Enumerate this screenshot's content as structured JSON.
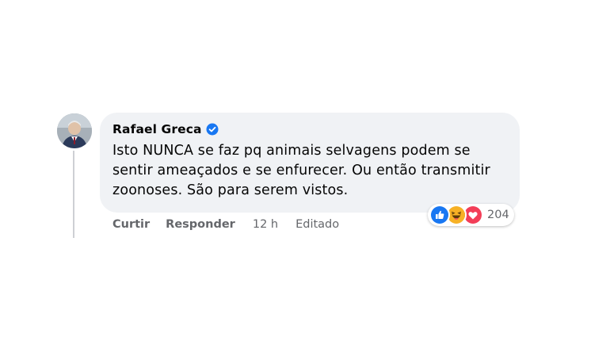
{
  "comment": {
    "author": "Rafael Greca",
    "verified": true,
    "text": "Isto NUNCA se faz pq animais selvagens podem se\nsentir ameaçados e se enfurecer. Ou então transmitir\nzoonoses. São para serem vistos.",
    "reactions": {
      "icons": [
        "like-icon",
        "haha-icon",
        "love-icon"
      ],
      "count": "204"
    },
    "actions": {
      "like_label": "Curtir",
      "reply_label": "Responder",
      "timestamp": "12 h",
      "edited_label": "Editado"
    }
  },
  "colors": {
    "bubble": "#f0f2f5",
    "name": "#050505",
    "meta": "#65676b",
    "verified": "#1877f2",
    "like": "#1877f2",
    "haha": "#f7b125",
    "love": "#f33e58"
  }
}
